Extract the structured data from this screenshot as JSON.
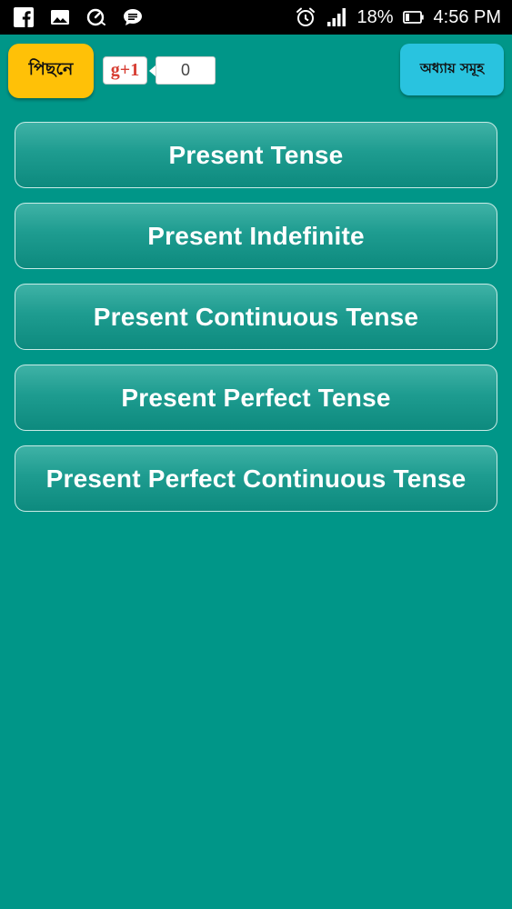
{
  "status_bar": {
    "icons_left": [
      "facebook-icon",
      "gallery-icon",
      "speed-icon",
      "message-icon"
    ],
    "icons_right": [
      "alarm-icon",
      "signal-icon",
      "battery-icon"
    ],
    "battery": "18%",
    "time": "4:56 PM"
  },
  "header": {
    "back_label": "পিছনে",
    "gplus_label": "g+1",
    "gplus_count": "0",
    "chapters_label": "অধ্যায় সমূহ",
    "colors": {
      "back_button": "#ffc107",
      "chapters_button": "#29c3df",
      "background": "#009688"
    }
  },
  "topics": [
    {
      "label": "Present Tense"
    },
    {
      "label": "Present Indefinite"
    },
    {
      "label": "Present Continuous Tense"
    },
    {
      "label": "Present Perfect Tense"
    },
    {
      "label": "Present Perfect Continuous Tense"
    }
  ]
}
